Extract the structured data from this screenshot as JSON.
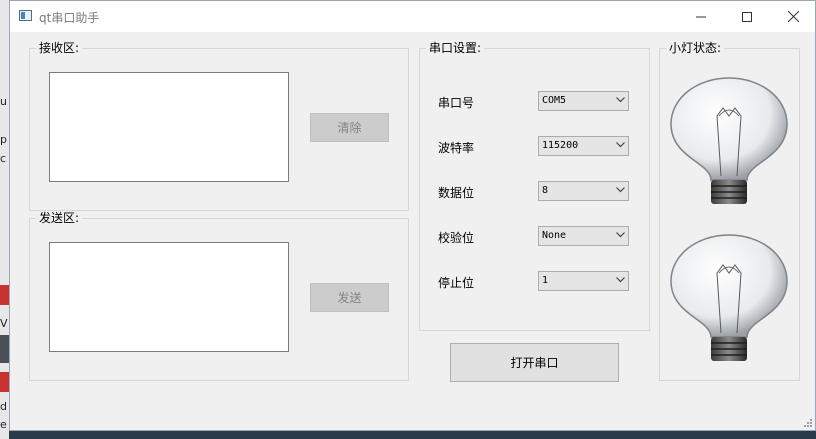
{
  "desktop": {
    "edge_fragments": [
      "u",
      "p",
      "c",
      "V",
      "d",
      "e"
    ]
  },
  "window": {
    "title": "qt串口助手",
    "controls": {
      "minimize_icon": "minimize-icon",
      "maximize_icon": "maximize-icon",
      "close_icon": "close-icon"
    }
  },
  "receive": {
    "group_title": "接收区:",
    "clear_label": "清除"
  },
  "send": {
    "group_title": "发送区:",
    "send_label": "发送"
  },
  "serial": {
    "group_title": "串口设置:",
    "fields": [
      {
        "label": "串口号",
        "value": "COM5"
      },
      {
        "label": "波特率",
        "value": "115200"
      },
      {
        "label": "数据位",
        "value": "8"
      },
      {
        "label": "校验位",
        "value": "None"
      },
      {
        "label": "停止位",
        "value": "1"
      }
    ],
    "open_label": "打开串口"
  },
  "lights": {
    "group_title": "小灯状态:",
    "bulbs": [
      "light-bulb-icon",
      "light-bulb-icon"
    ]
  },
  "colors": {
    "window_bg": "#f0f0f0",
    "disabled_button": "#cccccc",
    "button": "#e1e1e1"
  }
}
